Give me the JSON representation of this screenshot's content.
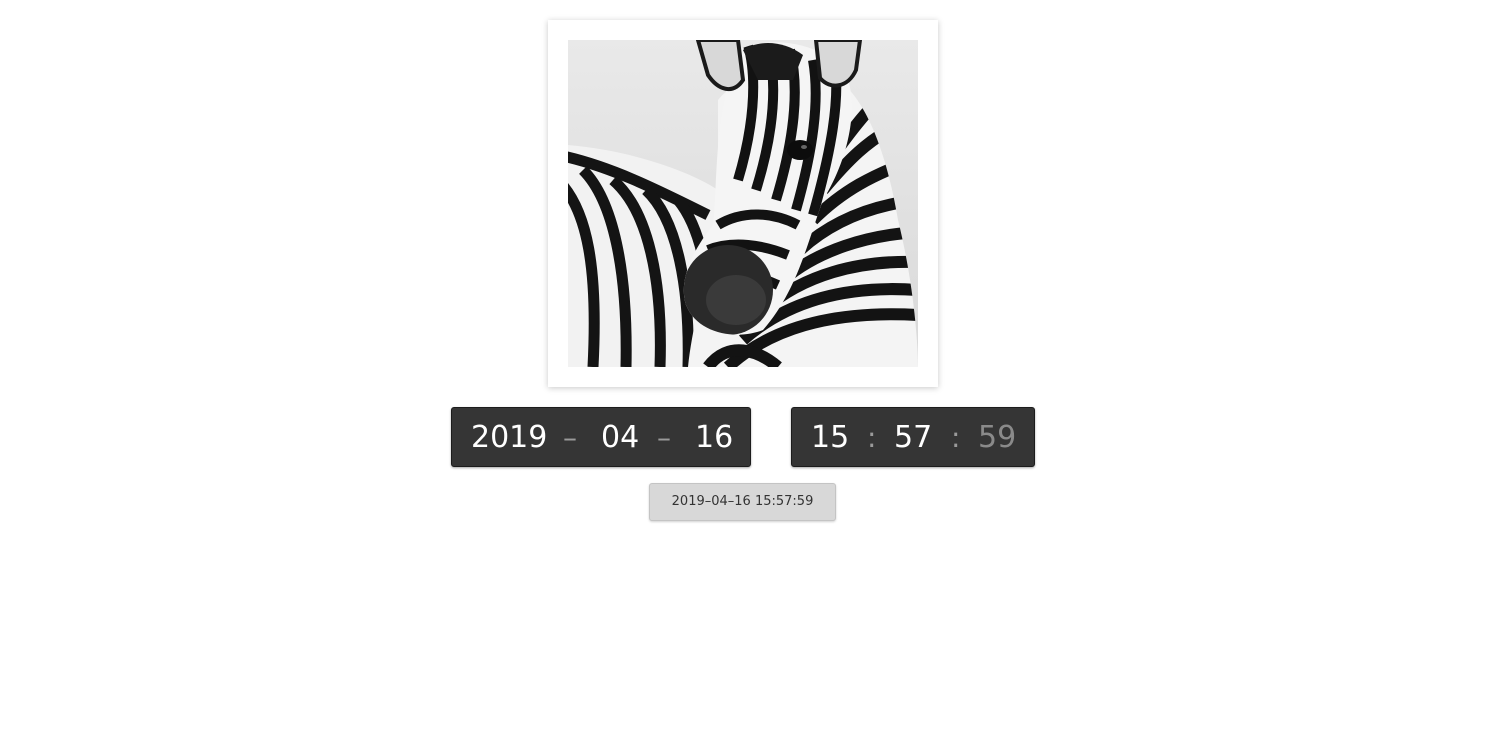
{
  "photo": {
    "subject": "zebra",
    "style": "black-and-white"
  },
  "date": {
    "year": "2019",
    "month": "04",
    "day": "16",
    "separator": "–"
  },
  "time": {
    "hours": "15",
    "minutes": "57",
    "seconds": "59",
    "separator": ":"
  },
  "timestamp_button": {
    "label": "2019–04–16 15:57:59"
  },
  "colors": {
    "clock_background": "#353535",
    "clock_text": "#ffffff",
    "seconds_text": "#8a8a8a",
    "button_background": "#d8d8d8"
  }
}
